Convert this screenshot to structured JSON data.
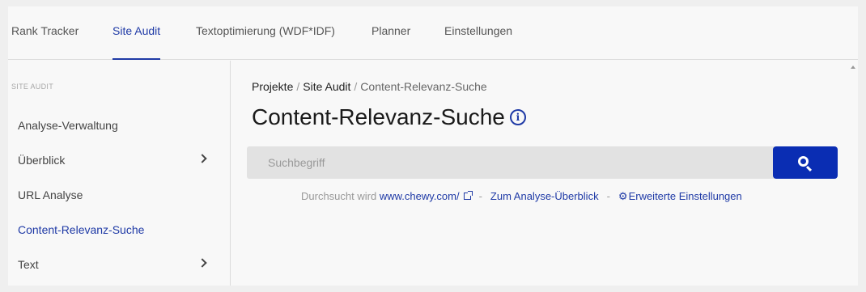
{
  "topnav": {
    "tabs": [
      {
        "label": "Rank Tracker"
      },
      {
        "label": "Site Audit"
      },
      {
        "label": "Textoptimierung (WDF*IDF)"
      },
      {
        "label": "Planner"
      },
      {
        "label": "Einstellungen"
      }
    ],
    "active_tab": "Site Audit"
  },
  "sidebar": {
    "section_label": "SITE AUDIT",
    "items": [
      {
        "label": "Analyse-Verwaltung",
        "has_chevron": false
      },
      {
        "label": "Überblick",
        "has_chevron": true
      },
      {
        "label": "URL Analyse",
        "has_chevron": false
      },
      {
        "label": "Content-Relevanz-Suche",
        "has_chevron": false
      },
      {
        "label": "Text",
        "has_chevron": true
      }
    ],
    "active_item": "Content-Relevanz-Suche"
  },
  "breadcrumb": {
    "items": [
      "Projekte",
      "Site Audit",
      "Content-Relevanz-Suche"
    ],
    "separator": "/"
  },
  "page": {
    "title": "Content-Relevanz-Suche",
    "info_icon_glyph": "i"
  },
  "search": {
    "placeholder": "Suchbegriff",
    "value": ""
  },
  "links": {
    "searched_prefix": "Durchsucht wird",
    "domain": "www.chewy.com/",
    "separator": "-",
    "overview": "Zum Analyse-Überblick",
    "advanced": "Erweiterte Einstellungen"
  },
  "icons": {
    "info": "info-icon",
    "chevron": "chevron-right-icon",
    "search": "search-icon",
    "external": "external-link-icon",
    "gear": "gear-icon"
  },
  "colors": {
    "accent": "#1f3aa6",
    "search_button": "#0a2db3",
    "search_field": "#e2e2e2"
  }
}
